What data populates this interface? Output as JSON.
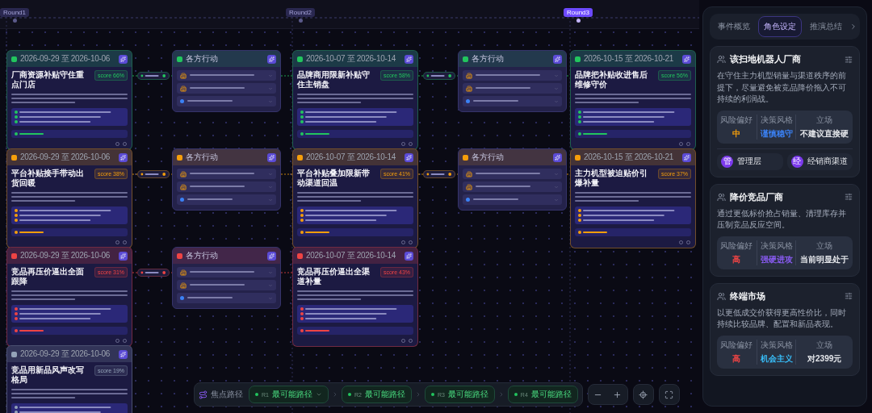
{
  "rounds": [
    {
      "label": "Round1",
      "selected": false,
      "scenarios": [
        {
          "date": "2026-09-29 至 2026-10-06",
          "title": "厂商资源补贴守住重点门店",
          "score": "score 66%",
          "color": "#22c55e"
        },
        {
          "date": "2026-09-29 至 2026-10-06",
          "title": "平台补贴接手带动出货回暖",
          "score": "score 38%",
          "color": "#f59e0b"
        },
        {
          "date": "2026-09-29 至 2026-10-06",
          "title": "竞品再压价逼出全面跟降",
          "score": "score 31%",
          "color": "#ef4444"
        },
        {
          "date": "2026-09-29 至 2026-10-06",
          "title": "竞品用新品风声改写格局",
          "score": "score 19%",
          "color": "#94a3b8"
        }
      ]
    },
    {
      "label": "Round2",
      "selected": false,
      "scenarios": [
        {
          "date": "2026-10-07 至 2026-10-14",
          "title": "品牌商用限新补贴守住主销盘",
          "score": "score 58%",
          "color": "#22c55e"
        },
        {
          "date": "2026-10-07 至 2026-10-14",
          "title": "平台补贴叠加限新带动渠道回温",
          "score": "score 41%",
          "color": "#f59e0b"
        },
        {
          "date": "2026-10-07 至 2026-10-14",
          "title": "竞品再压价逼出全渠道补量",
          "score": "score 43%",
          "color": "#ef4444"
        }
      ]
    },
    {
      "label": "Round3",
      "selected": true,
      "scenarios": [
        {
          "date": "2026-10-15 至 2026-10-21",
          "title": "品牌把补贴收进售后维修守价",
          "score": "score 56%",
          "color": "#22c55e"
        },
        {
          "date": "2026-10-15 至 2026-10-21",
          "title": "主力机型被迫贴价引爆补量",
          "score": "score 37%",
          "color": "#f59e0b"
        }
      ]
    }
  ],
  "transitions": [
    {
      "nodes": [
        {
          "title": "各方行动",
          "color": "#22c55e"
        },
        {
          "title": "各方行动",
          "color": "#f59e0b"
        },
        {
          "title": "各方行动",
          "color": "#ef4444"
        }
      ]
    },
    {
      "nodes": [
        {
          "title": "各方行动",
          "color": "#22c55e"
        },
        {
          "title": "各方行动",
          "color": "#f59e0b"
        }
      ]
    }
  ],
  "focus_bar": {
    "label": "焦点路径",
    "paths": [
      {
        "id": "R1",
        "label": "最可能路径",
        "has_menu": true
      },
      {
        "id": "R2",
        "label": "最可能路径",
        "has_menu": false
      },
      {
        "id": "R3",
        "label": "最可能路径",
        "has_menu": false
      },
      {
        "id": "R4",
        "label": "最可能路径",
        "has_menu": false
      }
    ]
  },
  "side_panel": {
    "tabs": [
      {
        "label": "事件概览",
        "selected": false
      },
      {
        "label": "角色设定",
        "selected": true
      },
      {
        "label": "推演总结",
        "selected": false
      }
    ],
    "roles": [
      {
        "name": "该扫地机器人厂商",
        "description": "在守住主力机型销量与渠道秩序的前提下，尽量避免被竞品降价拖入不可持续的利润战。",
        "stats": [
          {
            "label": "风险偏好",
            "value": "中",
            "color": "#f59e0b"
          },
          {
            "label": "决策风格",
            "value": "谨慎稳守",
            "color": "#3b82f6"
          },
          {
            "label": "立场",
            "value": "不建议直接硬",
            "color": "#e5e7eb"
          }
        ],
        "tags": [
          {
            "badge": "管",
            "label": "管理层"
          },
          {
            "badge": "经",
            "label": "经销商渠道"
          }
        ]
      },
      {
        "name": "降价竞品厂商",
        "description": "通过更低标价抢占销量、清理库存并压制竞品反应空间。",
        "stats": [
          {
            "label": "风险偏好",
            "value": "高",
            "color": "#ef4444"
          },
          {
            "label": "决策风格",
            "value": "强硬进攻",
            "color": "#8b5cf6"
          },
          {
            "label": "立场",
            "value": "当前明显处于",
            "color": "#e5e7eb"
          }
        ]
      },
      {
        "name": "终端市场",
        "description": "以更低成交价获得更高性价比，同时持续比较品牌、配置和新品表现。",
        "stats": [
          {
            "label": "风险偏好",
            "value": "高",
            "color": "#ef4444"
          },
          {
            "label": "决策风格",
            "value": "机会主义",
            "color": "#38bdf8"
          },
          {
            "label": "立场",
            "value": "对2399元",
            "color": "#e5e7eb"
          }
        ]
      }
    ]
  }
}
